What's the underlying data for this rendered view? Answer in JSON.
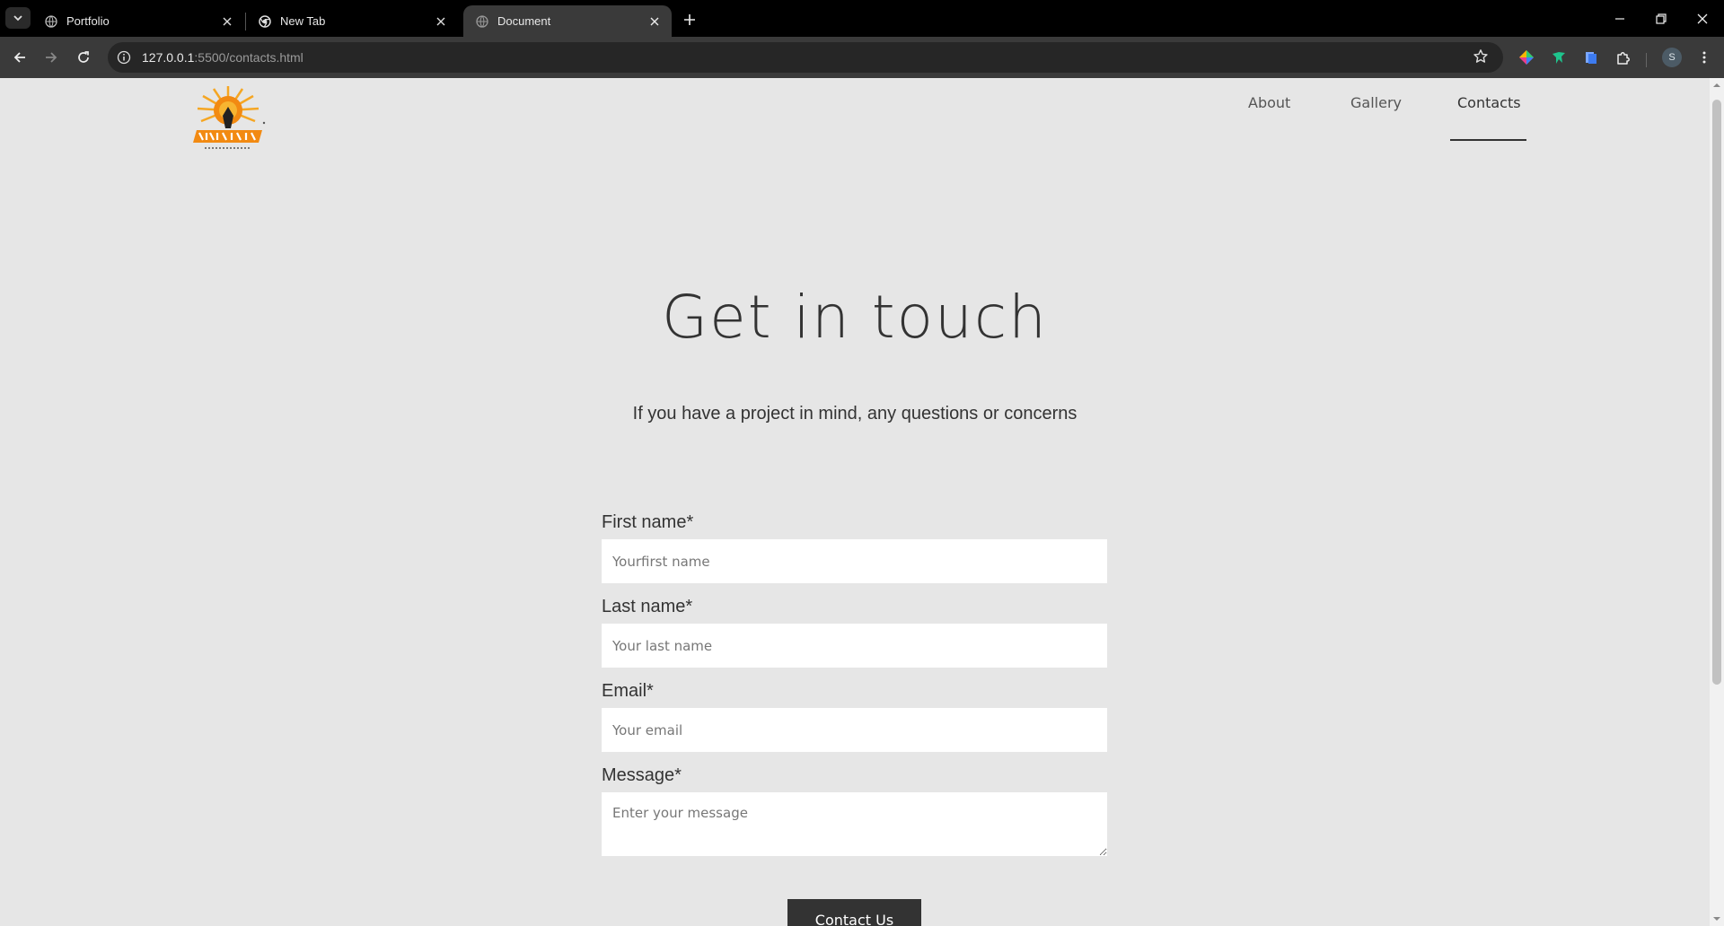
{
  "browser": {
    "tabs": [
      {
        "title": "Portfolio",
        "active": false
      },
      {
        "title": "New Tab",
        "active": false
      },
      {
        "title": "Document",
        "active": true
      }
    ],
    "url_host": "127.0.0.1",
    "url_rest": ":5500/contacts.html",
    "profile_initial": "S"
  },
  "site": {
    "nav": {
      "about": "About",
      "gallery": "Gallery",
      "contacts": "Contacts",
      "active": "contacts"
    },
    "heading": "Get in touch",
    "subheading": "If you have a project in mind, any questions or concerns",
    "form": {
      "first_name_label": "First name*",
      "first_name_placeholder": "Yourfirst name",
      "last_name_label": "Last name*",
      "last_name_placeholder": "Your last name",
      "email_label": "Email*",
      "email_placeholder": "Your email",
      "message_label": "Message*",
      "message_placeholder": "Enter your message",
      "submit_label": "Contact Us"
    }
  },
  "colors": {
    "page_background": "#e6e6e6",
    "text": "#333333",
    "button_background": "#333333",
    "logo_orange": "#f28a12"
  }
}
